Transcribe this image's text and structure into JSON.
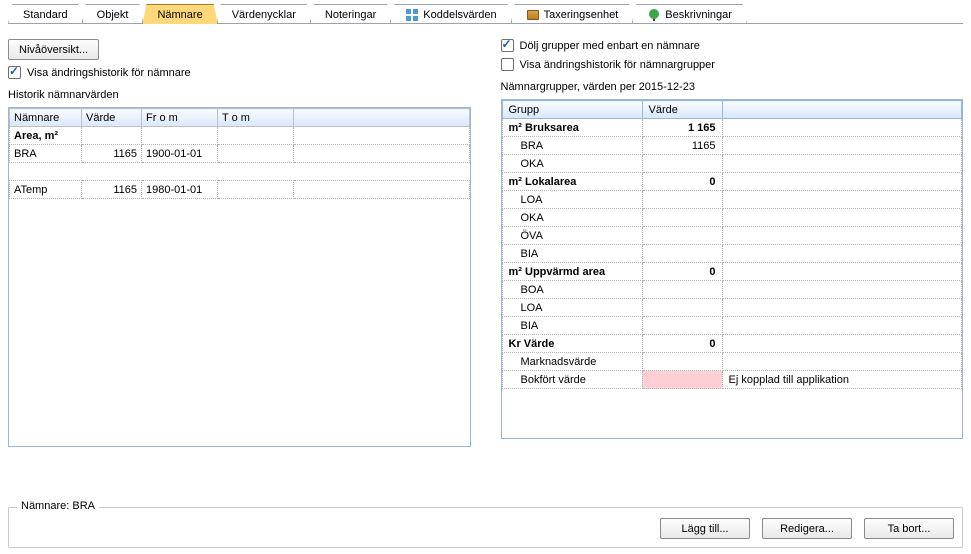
{
  "tabs": [
    {
      "label": "Standard"
    },
    {
      "label": "Objekt"
    },
    {
      "label": "Nämnare",
      "active": true
    },
    {
      "label": "Värdenycklar"
    },
    {
      "label": "Noteringar"
    },
    {
      "label": "Koddelsvärden",
      "icon": "grid"
    },
    {
      "label": "Taxeringsenhet",
      "icon": "box"
    },
    {
      "label": "Beskrivningar",
      "icon": "tree"
    }
  ],
  "left": {
    "overview_button": "Nivåöversikt...",
    "show_history": "Visa ändringshistorik för nämnare",
    "show_history_checked": true,
    "section_title": "Historik nämnarvärden",
    "headers": {
      "namnare": "Nämnare",
      "varde": "Värde",
      "from": "Fr o m",
      "tom": "T o m"
    },
    "rows": [
      {
        "bold": true,
        "namnare": "Area, m²",
        "varde": "",
        "from": "",
        "tom": ""
      },
      {
        "namnare": "BRA",
        "varde": "1165",
        "from": "1900-01-01",
        "tom": ""
      },
      {
        "gap": true
      },
      {
        "namnare": "ATemp",
        "varde": "1165",
        "from": "1980-01-01",
        "tom": ""
      }
    ]
  },
  "right": {
    "hide_groups": "Dölj grupper med enbart en nämnare",
    "hide_groups_checked": true,
    "show_group_history": "Visa ändringshistorik för nämnargrupper",
    "show_group_history_checked": false,
    "section_title": "Nämnargrupper, värden per 2015-12-23",
    "headers": {
      "grupp": "Grupp",
      "varde": "Värde"
    },
    "rows": [
      {
        "group": true,
        "grupp": "m² Bruksarea",
        "varde": "1 165"
      },
      {
        "grupp": "BRA",
        "varde": "1165"
      },
      {
        "grupp": "OKA",
        "varde": ""
      },
      {
        "group": true,
        "grupp": "m² Lokalarea",
        "varde": "0"
      },
      {
        "grupp": "LOA",
        "varde": ""
      },
      {
        "grupp": "OKA",
        "varde": ""
      },
      {
        "grupp": "ÖVA",
        "varde": ""
      },
      {
        "grupp": "BIA",
        "varde": ""
      },
      {
        "group": true,
        "grupp": "m² Uppvärmd area",
        "varde": "0"
      },
      {
        "grupp": "BOA",
        "varde": ""
      },
      {
        "grupp": "LOA",
        "varde": ""
      },
      {
        "grupp": "BIA",
        "varde": ""
      },
      {
        "group": true,
        "grupp": "Kr Värde",
        "varde": "0"
      },
      {
        "grupp": "Marknadsvärde",
        "varde": ""
      },
      {
        "grupp": "Bokfört värde",
        "varde": "",
        "pink": true,
        "note": "Ej kopplad till applikation"
      }
    ]
  },
  "footer": {
    "label": "Nämnare: BRA",
    "add": "Lägg till...",
    "edit": "Redigera...",
    "delete": "Ta bort..."
  }
}
